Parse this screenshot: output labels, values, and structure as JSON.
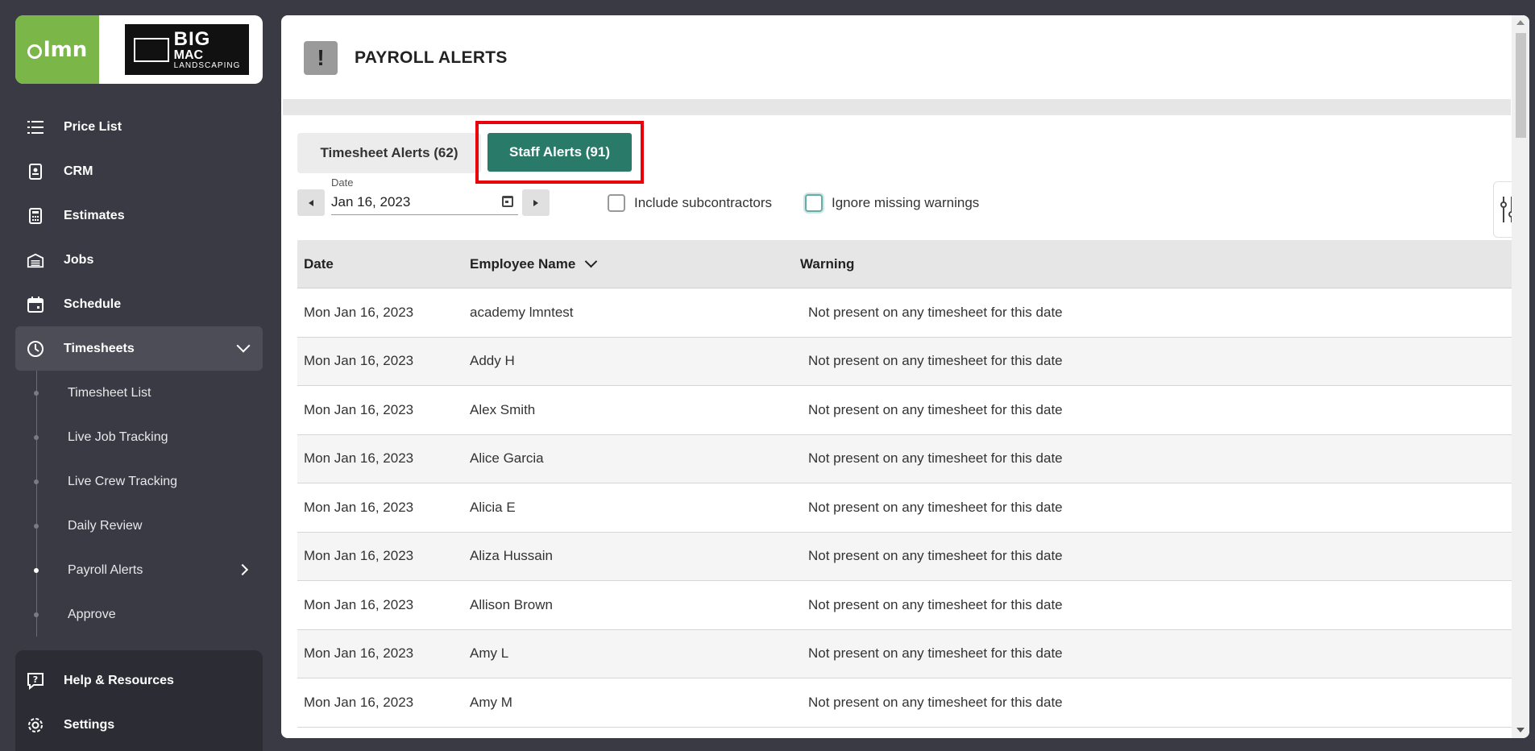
{
  "brand": {
    "lmn_logo": "lmn",
    "company_logo_big": "BIG",
    "company_logo_mac": "MAC",
    "company_logo_sub": "LANDSCAPING"
  },
  "sidebar": {
    "items": [
      {
        "label": "Price List",
        "icon": "list-icon"
      },
      {
        "label": "CRM",
        "icon": "contact-card-icon"
      },
      {
        "label": "Estimates",
        "icon": "calculator-icon"
      },
      {
        "label": "Jobs",
        "icon": "warehouse-icon"
      },
      {
        "label": "Schedule",
        "icon": "calendar-icon"
      },
      {
        "label": "Timesheets",
        "icon": "clock-icon"
      }
    ],
    "timesheets_sub": [
      {
        "label": "Timesheet List"
      },
      {
        "label": "Live Job Tracking"
      },
      {
        "label": "Live Crew Tracking"
      },
      {
        "label": "Daily Review"
      },
      {
        "label": "Payroll Alerts"
      },
      {
        "label": "Approve"
      }
    ],
    "bottom": [
      {
        "label": "Help & Resources",
        "icon": "help-chat-icon"
      },
      {
        "label": "Settings",
        "icon": "gear-icon"
      }
    ]
  },
  "header": {
    "title": "PAYROLL ALERTS",
    "icon": "exclamation-icon"
  },
  "tabs": {
    "timesheet": "Timesheet Alerts (62)",
    "staff": "Staff Alerts (91)"
  },
  "filters": {
    "date_label": "Date",
    "date_value": "Jan 16, 2023",
    "include_subcontractors": "Include subcontractors",
    "ignore_missing": "Ignore missing warnings"
  },
  "table": {
    "columns": [
      "Date",
      "Employee Name",
      "Warning"
    ],
    "rows": [
      {
        "date": "Mon Jan 16, 2023",
        "name": "academy lmntest",
        "warning": "Not present on any timesheet for this date"
      },
      {
        "date": "Mon Jan 16, 2023",
        "name": "Addy H",
        "warning": "Not present on any timesheet for this date"
      },
      {
        "date": "Mon Jan 16, 2023",
        "name": "Alex Smith",
        "warning": "Not present on any timesheet for this date"
      },
      {
        "date": "Mon Jan 16, 2023",
        "name": "Alice Garcia",
        "warning": "Not present on any timesheet for this date"
      },
      {
        "date": "Mon Jan 16, 2023",
        "name": "Alicia E",
        "warning": "Not present on any timesheet for this date"
      },
      {
        "date": "Mon Jan 16, 2023",
        "name": "Aliza Hussain",
        "warning": "Not present on any timesheet for this date"
      },
      {
        "date": "Mon Jan 16, 2023",
        "name": "Allison Brown",
        "warning": "Not present on any timesheet for this date"
      },
      {
        "date": "Mon Jan 16, 2023",
        "name": "Amy L",
        "warning": "Not present on any timesheet for this date"
      },
      {
        "date": "Mon Jan 16, 2023",
        "name": "Amy M",
        "warning": "Not present on any timesheet for this date"
      }
    ]
  },
  "colors": {
    "accent": "#2a7a6a",
    "highlight": "#e8000a",
    "lmn_green": "#7ab648",
    "sidebar_bg": "#3a3a44"
  }
}
